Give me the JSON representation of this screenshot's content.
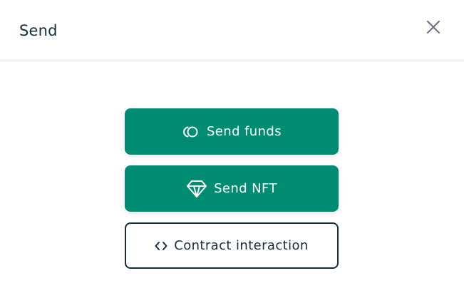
{
  "modal": {
    "title": "Send",
    "close_icon": "close-icon"
  },
  "actions": [
    {
      "label": "Send funds",
      "icon": "coins-icon",
      "style": "primary"
    },
    {
      "label": "Send NFT",
      "icon": "diamond-icon",
      "style": "primary"
    },
    {
      "label": "Contract interaction",
      "icon": "code-icon",
      "style": "outline"
    }
  ],
  "colors": {
    "primary": "#008c73",
    "text_dark": "#162c3a",
    "divider": "#dcdfe3",
    "background": "#ffffff"
  }
}
